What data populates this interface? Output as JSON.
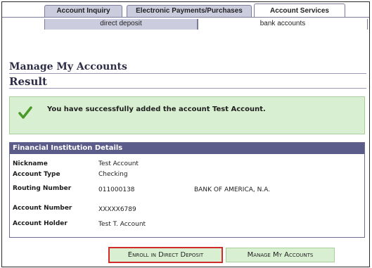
{
  "tabs": [
    {
      "label": "Account Inquiry"
    },
    {
      "label": "Electronic Payments/Purchases"
    },
    {
      "label": "Account Services"
    }
  ],
  "subtabs": [
    {
      "label": "direct deposit"
    },
    {
      "label": "bank accounts"
    }
  ],
  "page": {
    "title": "Manage My Accounts",
    "subtitle": "Result"
  },
  "success": {
    "icon": "check-icon",
    "message": "You have successfully added the account Test Account."
  },
  "details": {
    "header": "Financial Institution Details",
    "rows": [
      {
        "label": "Nickname",
        "value": "Test Account"
      },
      {
        "label": "Account Type",
        "value": "Checking"
      },
      {
        "label": "Routing Number",
        "value": "011000138",
        "extra": "BANK OF AMERICA, N.A."
      },
      {
        "label": "Account Number",
        "value": "XXXXX6789"
      },
      {
        "label": "Account Holder",
        "value": "Test T. Account"
      }
    ]
  },
  "buttons": {
    "enroll": "Enroll in Direct Deposit",
    "manage": "Manage My Accounts"
  },
  "colors": {
    "tab_bg": "#ccccdf",
    "panel_header": "#5c5c8a",
    "success_bg": "#d9efd1",
    "highlight": "#d12a2a"
  }
}
